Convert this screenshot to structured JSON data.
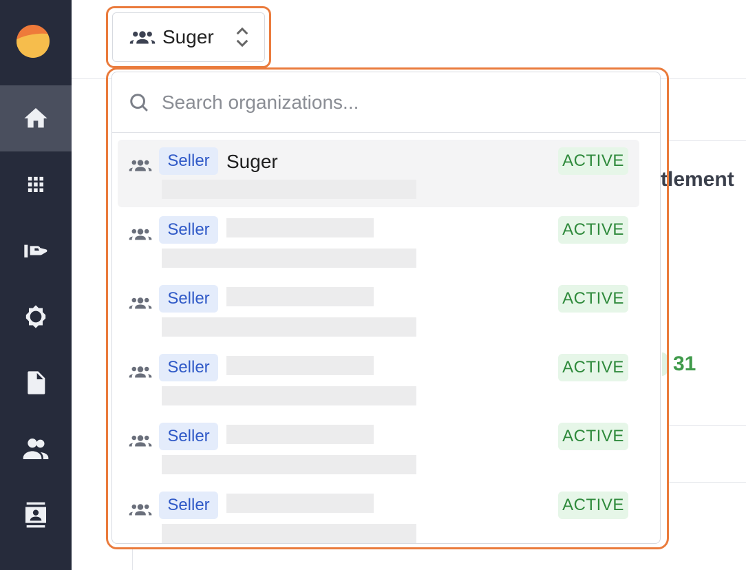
{
  "app": {
    "selected_org": "Suger"
  },
  "sidebar": {
    "items": [
      {
        "icon": "home-icon",
        "active": true
      },
      {
        "icon": "apps-grid-icon",
        "active": false
      },
      {
        "icon": "hand-offer-icon",
        "active": false
      },
      {
        "icon": "settings-cog-icon",
        "active": false
      },
      {
        "icon": "document-icon",
        "active": false
      },
      {
        "icon": "users-icon",
        "active": false
      },
      {
        "icon": "contacts-icon",
        "active": false
      }
    ]
  },
  "background": {
    "heading_fragment": "tlement",
    "count_fragment": "31"
  },
  "dropdown": {
    "search_placeholder": "Search organizations...",
    "items": [
      {
        "tag": "Seller",
        "name": "Suger",
        "status": "ACTIVE"
      },
      {
        "tag": "Seller",
        "name": "",
        "status": "ACTIVE"
      },
      {
        "tag": "Seller",
        "name": "",
        "status": "ACTIVE"
      },
      {
        "tag": "Seller",
        "name": "",
        "status": "ACTIVE"
      },
      {
        "tag": "Seller",
        "name": "",
        "status": "ACTIVE"
      },
      {
        "tag": "Seller",
        "name": "",
        "status": "ACTIVE"
      }
    ]
  },
  "colors": {
    "sidebar_bg": "#262b3b",
    "highlight_outline": "#ea7b3c",
    "tag_bg": "#e4ecfb",
    "tag_text": "#2f59c7",
    "status_bg": "#e6f6e8",
    "status_text": "#2f8a3c"
  }
}
